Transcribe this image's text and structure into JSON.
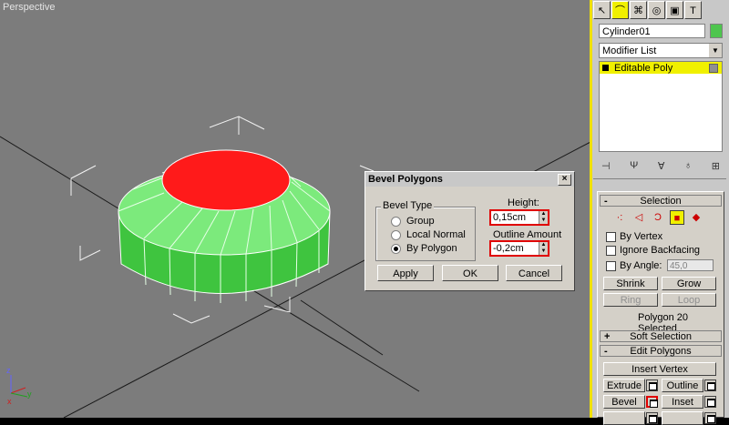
{
  "viewport": {
    "label": "Perspective"
  },
  "dialog": {
    "title": "Bevel Polygons",
    "close": "×",
    "bevel_type": {
      "label": "Bevel Type",
      "options": [
        "Group",
        "Local Normal",
        "By Polygon"
      ],
      "selected": "By Polygon"
    },
    "height": {
      "label": "Height:",
      "value": "0,15cm"
    },
    "outline": {
      "label": "Outline Amount",
      "value": "-0,2cm"
    },
    "buttons": {
      "apply": "Apply",
      "ok": "OK",
      "cancel": "Cancel"
    }
  },
  "command_panel": {
    "object_name": "Cylinder01",
    "object_color": "#4ec54e",
    "modifier_list": "Modifier List",
    "stack": [
      "Editable Poly"
    ],
    "selection": {
      "title": "Selection",
      "by_vertex": "By Vertex",
      "ignore_backfacing": "Ignore Backfacing",
      "by_angle": "By Angle:",
      "angle_value": "45,0",
      "shrink": "Shrink",
      "grow": "Grow",
      "ring": "Ring",
      "loop": "Loop",
      "status": "Polygon 20 Selected"
    },
    "soft_selection": {
      "title": "Soft Selection"
    },
    "edit_polygons": {
      "title": "Edit Polygons",
      "insert_vertex": "Insert Vertex",
      "extrude": "Extrude",
      "outline": "Outline",
      "bevel": "Bevel",
      "inset": "Inset"
    }
  },
  "colors": {
    "selected_face": "#ff1a1a",
    "mesh_green": "#3fc43f",
    "active_yellow": "#f0f000",
    "highlight_red": "#e00000"
  }
}
